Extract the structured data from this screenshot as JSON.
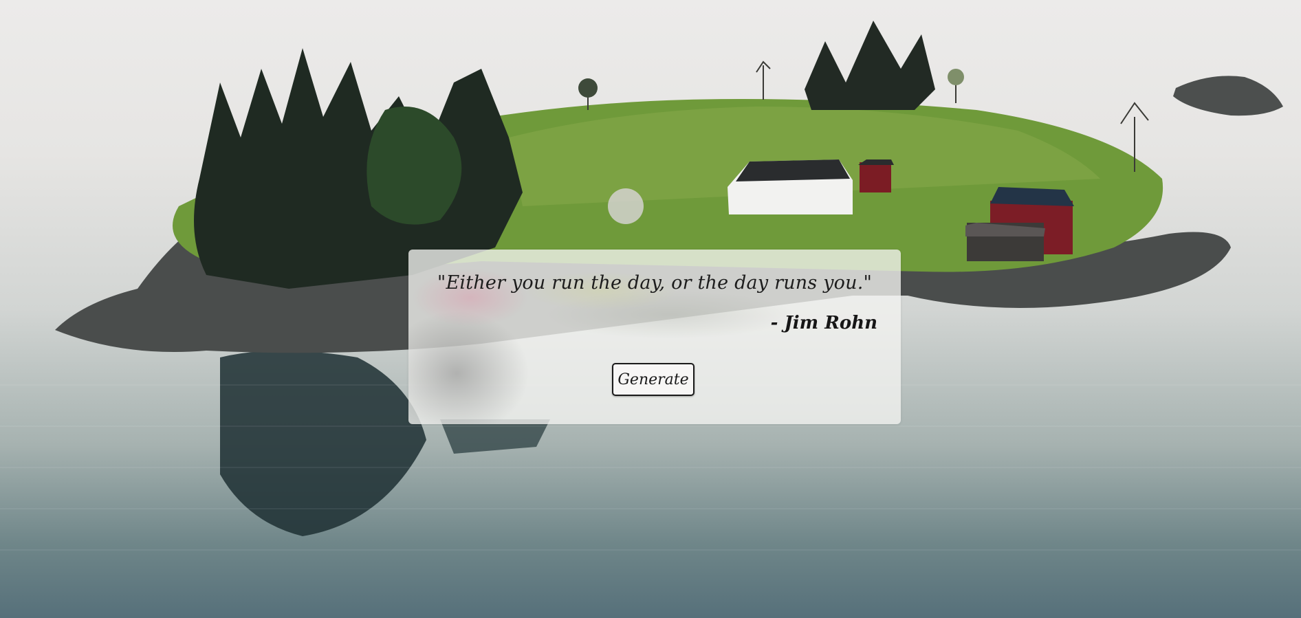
{
  "quote_box": {
    "quote_text": "\"Either you run the day, or the day runs you.\"",
    "author": "- Jim Rohn",
    "generate_label": "Generate"
  },
  "colors": {
    "text": "#1c1c1c",
    "card_background": "#f4f3f1",
    "water": "#6f8689",
    "grass": "#6f9a3a"
  }
}
